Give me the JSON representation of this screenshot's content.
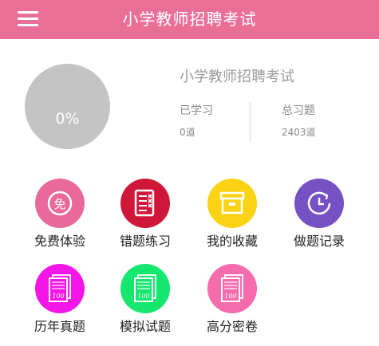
{
  "header": {
    "title": "小学教师招聘考试",
    "background": "#ea6f96"
  },
  "progress": {
    "percent_text": "0%",
    "value": 0
  },
  "course": {
    "name": "小学教师招聘考试"
  },
  "stats": {
    "studied": {
      "label": "已学习",
      "value": "0道"
    },
    "total": {
      "label": "总习题",
      "value": "2403道"
    }
  },
  "features": [
    {
      "label": "免费体验",
      "icon": "free-badge-icon",
      "color": "#e8699a"
    },
    {
      "label": "错题练习",
      "icon": "list-error-icon",
      "color": "#cf1839"
    },
    {
      "label": "我的收藏",
      "icon": "archive-box-icon",
      "color": "#fbd314"
    },
    {
      "label": "做题记录",
      "icon": "clock-history-icon",
      "color": "#7651c4"
    },
    {
      "label": "历年真题",
      "icon": "exam-paper-icon",
      "color": "#f316e6"
    },
    {
      "label": "模拟试题",
      "icon": "exam-paper-icon",
      "color": "#16e76e"
    },
    {
      "label": "高分密卷",
      "icon": "exam-paper-icon",
      "color": "#f56cad"
    }
  ]
}
